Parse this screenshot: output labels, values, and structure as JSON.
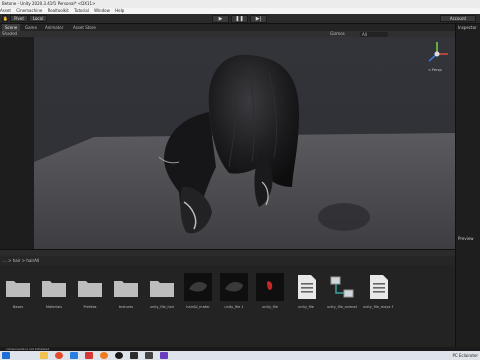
{
  "window": {
    "title": "Betone - Unity 2020.3.41f1 Personal* <DX11>"
  },
  "menu": [
    "Asset",
    "Cinemachine",
    "Realtoolkit",
    "Tutorial",
    "Window",
    "Help"
  ],
  "toolbar": {
    "pivot_label": "Pivot",
    "local_label": "Local",
    "account_label": "Account"
  },
  "tabs": [
    {
      "label": "Scene",
      "active": true
    },
    {
      "label": "Game",
      "active": false
    },
    {
      "label": "Animator",
      "active": false
    },
    {
      "label": "Asset Store",
      "active": false
    }
  ],
  "scene_options": {
    "shading": "Shaded",
    "gizmos": "Gizmos",
    "search": "All"
  },
  "gizmo": {
    "persp_label": "< Persp"
  },
  "inspector": {
    "label": "Inspector"
  },
  "preview": {
    "label": "Preview"
  },
  "path": {
    "crumbs": "... > hair > hairAll"
  },
  "assets": [
    {
      "label": "Bases",
      "kind": "folder"
    },
    {
      "label": "Materials",
      "kind": "folder"
    },
    {
      "label": "Prefabs",
      "kind": "folder"
    },
    {
      "label": "textures",
      "kind": "folder"
    },
    {
      "label": "unity_file_hair",
      "kind": "folder"
    },
    {
      "label": "hairAll_mater",
      "kind": "mesh"
    },
    {
      "label": "unity_file 1",
      "kind": "mesh"
    },
    {
      "label": "unity_file",
      "kind": "red"
    },
    {
      "label": "unity_file",
      "kind": "doc"
    },
    {
      "label": "unity_file_animat...",
      "kind": "graph"
    },
    {
      "label": "unity_file_maya N...",
      "kind": "doc"
    }
  ],
  "console": {
    "message": "components is not initialized"
  },
  "tray": {
    "label": "PC  Eclairoter"
  }
}
